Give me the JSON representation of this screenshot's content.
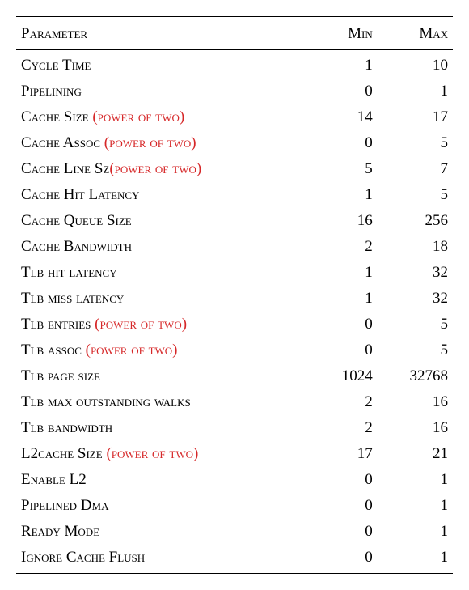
{
  "headers": {
    "parameter": "Parameter",
    "min": "Min",
    "max": "Max"
  },
  "note_text": "(power of two)",
  "rows": [
    {
      "name": "Cycle Time",
      "note": false,
      "min": "1",
      "max": "10"
    },
    {
      "name": "Pipelining",
      "note": false,
      "min": "0",
      "max": "1"
    },
    {
      "name": "Cache Size ",
      "note": true,
      "min": "14",
      "max": "17"
    },
    {
      "name": "Cache Assoc ",
      "note": true,
      "min": "0",
      "max": "5"
    },
    {
      "name": "Cache Line Sz",
      "note": true,
      "min": "5",
      "max": "7"
    },
    {
      "name": "Cache Hit Latency",
      "note": false,
      "min": "1",
      "max": "5"
    },
    {
      "name": "Cache Queue Size",
      "note": false,
      "min": "16",
      "max": "256"
    },
    {
      "name": "Cache Bandwidth",
      "note": false,
      "min": "2",
      "max": "18"
    },
    {
      "name": "Tlb hit latency",
      "note": false,
      "min": "1",
      "max": "32"
    },
    {
      "name": "Tlb miss latency",
      "note": false,
      "min": "1",
      "max": "32"
    },
    {
      "name": "Tlb entries ",
      "note": true,
      "min": "0",
      "max": "5"
    },
    {
      "name": "Tlb assoc ",
      "note": true,
      "min": "0",
      "max": "5"
    },
    {
      "name": "Tlb page size",
      "note": false,
      "min": "1024",
      "max": "32768"
    },
    {
      "name": "Tlb max outstanding walks",
      "note": false,
      "min": "2",
      "max": "16"
    },
    {
      "name": "Tlb bandwidth",
      "note": false,
      "min": "2",
      "max": "16"
    },
    {
      "name": "L2cache Size ",
      "note": true,
      "min": "17",
      "max": "21"
    },
    {
      "name": "Enable L2",
      "note": false,
      "min": "0",
      "max": "1"
    },
    {
      "name": "Pipelined Dma",
      "note": false,
      "min": "0",
      "max": "1"
    },
    {
      "name": "Ready Mode",
      "note": false,
      "min": "0",
      "max": "1"
    },
    {
      "name": "Ignore Cache Flush",
      "note": false,
      "min": "0",
      "max": "1"
    }
  ],
  "chart_data": {
    "type": "table",
    "title": "",
    "columns": [
      "Parameter",
      "Min",
      "Max"
    ],
    "rows": [
      [
        "Cycle Time",
        1,
        10
      ],
      [
        "Pipelining",
        0,
        1
      ],
      [
        "Cache Size (power of two)",
        14,
        17
      ],
      [
        "Cache Assoc (power of two)",
        0,
        5
      ],
      [
        "Cache Line Sz (power of two)",
        5,
        7
      ],
      [
        "Cache Hit Latency",
        1,
        5
      ],
      [
        "Cache Queue Size",
        16,
        256
      ],
      [
        "Cache Bandwidth",
        2,
        18
      ],
      [
        "Tlb hit latency",
        1,
        32
      ],
      [
        "Tlb miss latency",
        1,
        32
      ],
      [
        "Tlb entries (power of two)",
        0,
        5
      ],
      [
        "Tlb assoc (power of two)",
        0,
        5
      ],
      [
        "Tlb page size",
        1024,
        32768
      ],
      [
        "Tlb max outstanding walks",
        2,
        16
      ],
      [
        "Tlb bandwidth",
        2,
        16
      ],
      [
        "L2cache Size (power of two)",
        17,
        21
      ],
      [
        "Enable L2",
        0,
        1
      ],
      [
        "Pipelined Dma",
        0,
        1
      ],
      [
        "Ready Mode",
        0,
        1
      ],
      [
        "Ignore Cache Flush",
        0,
        1
      ]
    ]
  }
}
